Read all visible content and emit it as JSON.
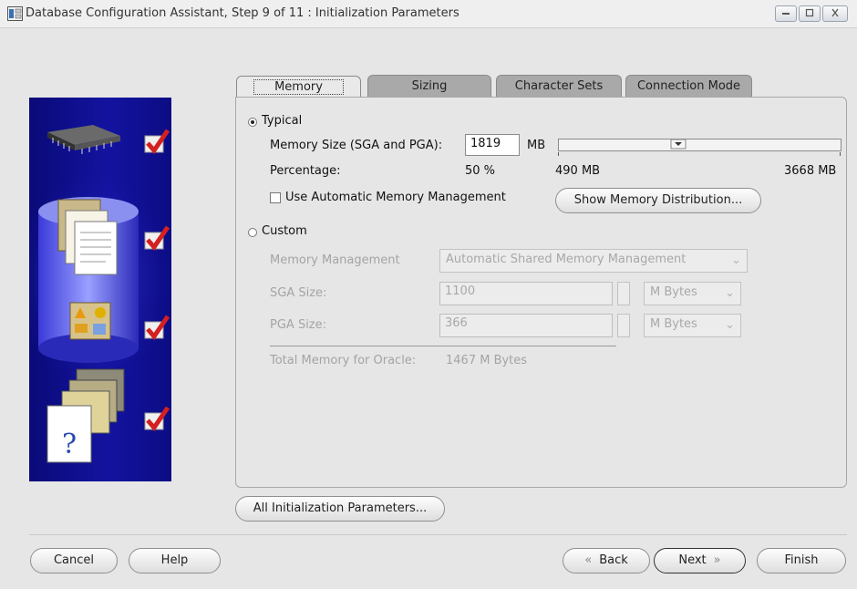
{
  "window": {
    "title": "Database Configuration Assistant, Step 9 of 11 : Initialization Parameters"
  },
  "tabs": [
    {
      "label": "Memory",
      "active": true
    },
    {
      "label": "Sizing",
      "active": false
    },
    {
      "label": "Character Sets",
      "active": false
    },
    {
      "label": "Connection Mode",
      "active": false
    }
  ],
  "typical": {
    "label": "Typical",
    "selected": true,
    "memory_size_label": "Memory Size (SGA and PGA):",
    "memory_size_value": "1819",
    "memory_unit": "MB",
    "percentage_label": "Percentage:",
    "percentage_value": "50 %",
    "slider_min_label": "490 MB",
    "slider_max_label": "3668 MB",
    "slider_level_fraction": 0.42,
    "use_amm_label": "Use Automatic Memory Management",
    "use_amm_checked": false,
    "show_distribution_button": "Show Memory Distribution..."
  },
  "custom": {
    "label": "Custom",
    "selected": false,
    "memory_management_label": "Memory Management",
    "memory_management_value": "Automatic Shared Memory Management",
    "sga_label": "SGA Size:",
    "sga_value": "1100",
    "sga_unit": "M Bytes",
    "pga_label": "PGA Size:",
    "pga_value": "366",
    "pga_unit": "M Bytes",
    "total_label": "Total Memory for Oracle:",
    "total_value": "1467 M Bytes"
  },
  "all_params_button": "All Initialization Parameters...",
  "footer": {
    "cancel": "Cancel",
    "help": "Help",
    "back": "Back",
    "next": "Next",
    "finish": "Finish"
  },
  "icons": [
    "database-window-icon",
    "minimize-icon",
    "maximize-icon",
    "close-icon",
    "chip-icon",
    "documents-icon",
    "database-cylinder-icon",
    "shapes-icon",
    "folders-icon",
    "help-document-icon",
    "checkmark-icon"
  ],
  "colors": {
    "side_panel": "#12129a",
    "check_red": "#d42020"
  }
}
